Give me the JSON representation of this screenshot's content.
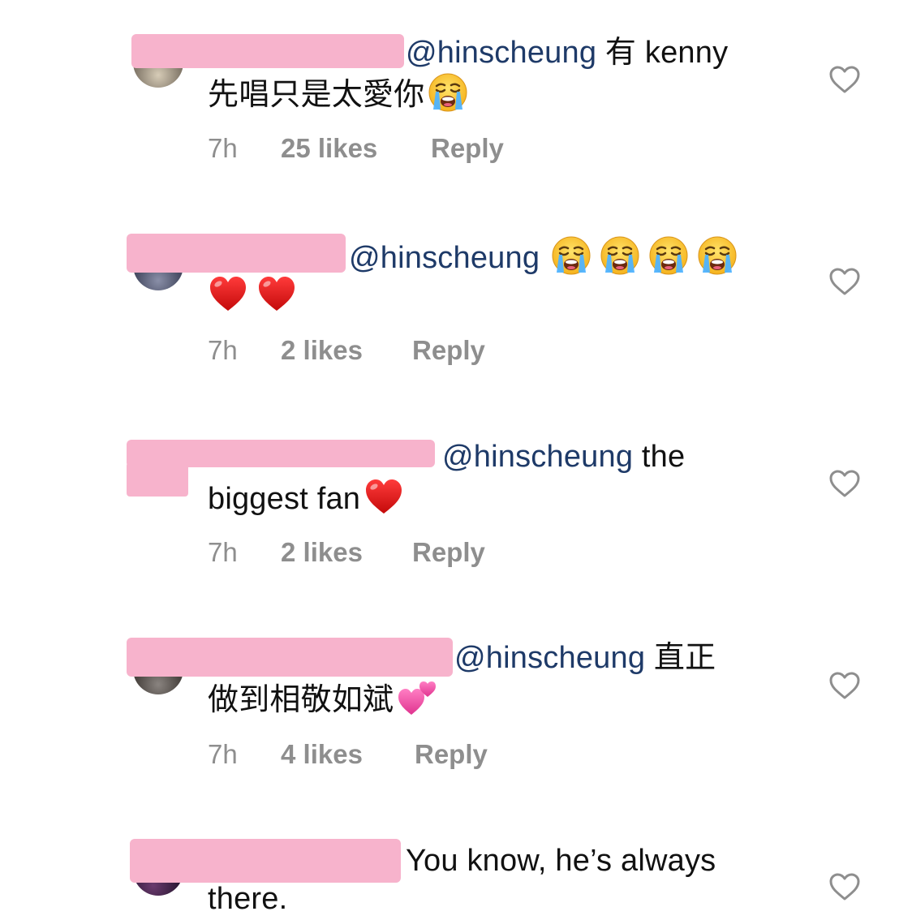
{
  "comments": [
    {
      "mention": "@hinscheung",
      "line1_text": " 有 kenny",
      "line2_text": "先唱只是太愛你",
      "line2_emojis": [
        "loudly-crying-face"
      ],
      "time": "7h",
      "likes": "25 likes",
      "reply": "Reply"
    },
    {
      "mention": "@hinscheung",
      "line1_emojis": [
        "loudly-crying-face",
        "loudly-crying-face",
        "loudly-crying-face",
        "loudly-crying-face"
      ],
      "line2_emojis": [
        "red-heart",
        "red-heart"
      ],
      "time": "7h",
      "likes": "2 likes",
      "reply": "Reply"
    },
    {
      "mention": "@hinscheung",
      "line1_text": " the",
      "line2_text": "biggest fan",
      "line2_emojis": [
        "red-heart"
      ],
      "time": "7h",
      "likes": "2 likes",
      "reply": "Reply"
    },
    {
      "mention": "@hinscheung",
      "line1_text": " 直正",
      "line2_text": "做到相敬如斌",
      "line2_emojis": [
        "two-hearts"
      ],
      "time": "7h",
      "likes": "4 likes",
      "reply": "Reply"
    },
    {
      "line1_text": "You know, he’s always",
      "line2_text": "there."
    }
  ],
  "colors": {
    "mention": "#1e3a68",
    "meta": "#8e8e8e",
    "redaction": "#f7b3cc",
    "heart_outline": "#8e8e8e"
  },
  "icons": [
    "heart-outline-icon",
    "loudly-crying-face-emoji",
    "red-heart-emoji",
    "two-hearts-emoji"
  ]
}
